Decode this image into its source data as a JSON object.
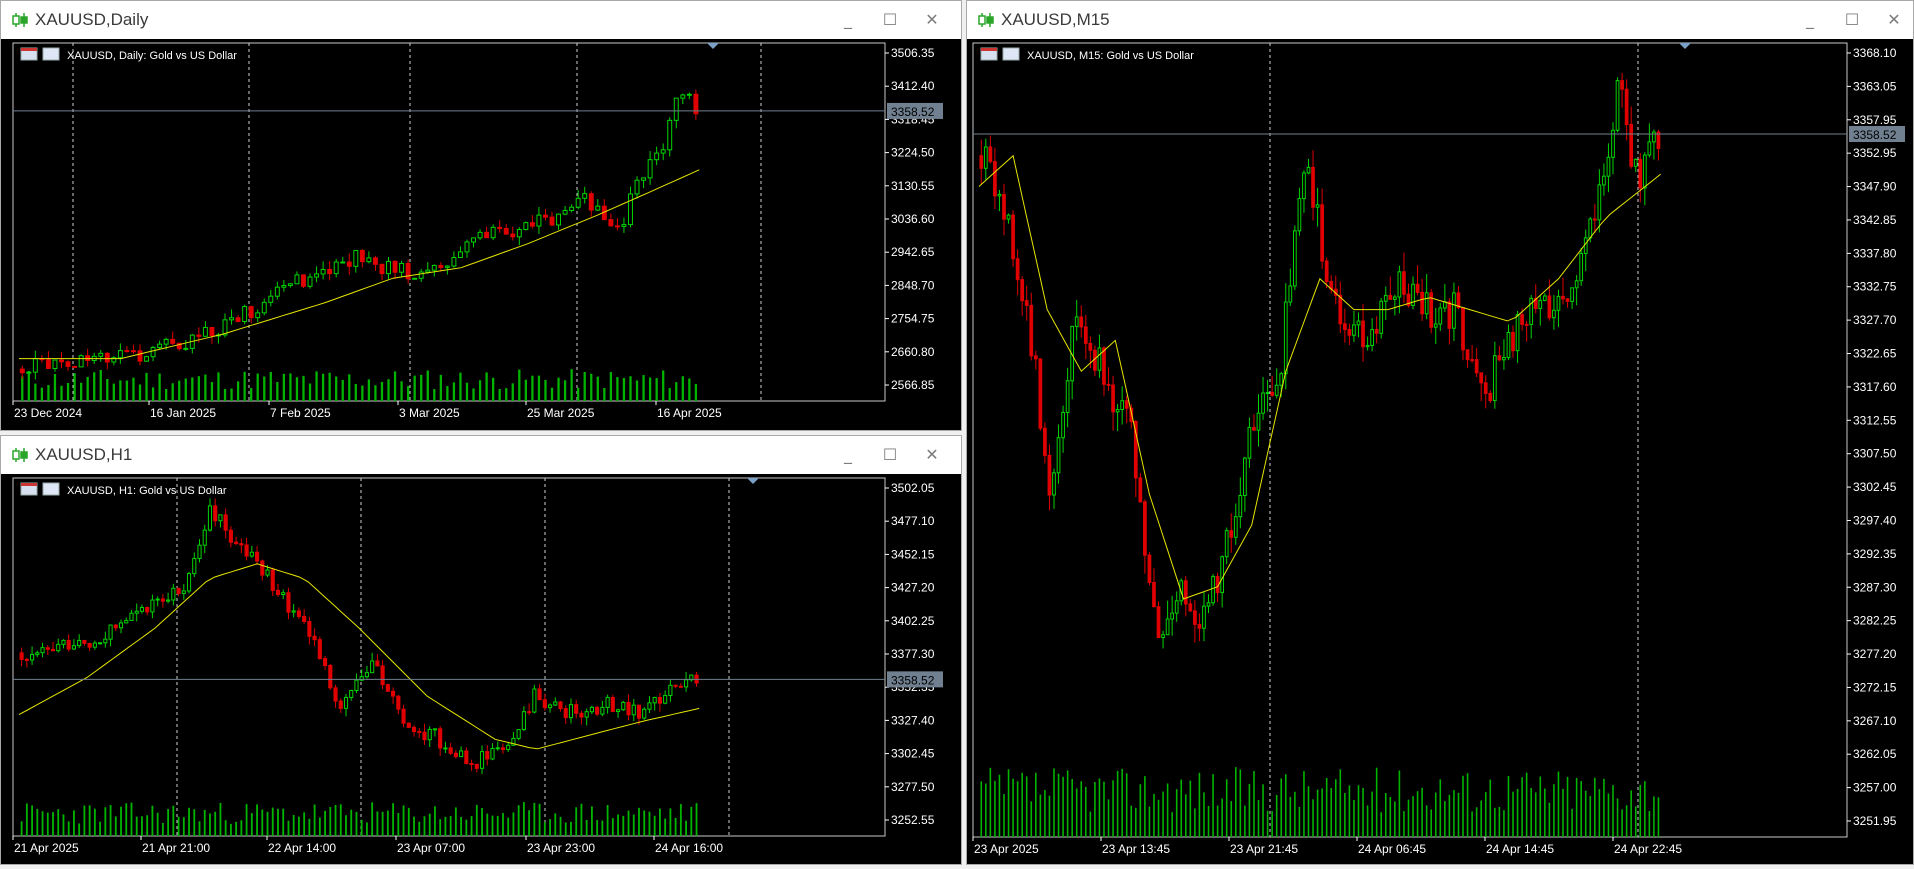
{
  "theme": {
    "bg": "#000000",
    "bull": "#00d400",
    "bear": "#e00000",
    "ma": "#e6e600",
    "volume": "#00b400",
    "axis": "#ffffff",
    "grid": "#cfcfcf",
    "price_line": "#708090",
    "price_tag_bg": "#708090"
  },
  "windows": [
    {
      "id": "daily",
      "title": "XAUUSD,Daily",
      "legend": "XAUUSD, Daily:  Gold vs US Dollar",
      "current_price": "3358.52",
      "price_level": 3358.52,
      "y_ticks": [
        "3506.35",
        "3412.40",
        "3318.45",
        "3224.50",
        "3130.55",
        "3036.60",
        "2942.65",
        "2848.70",
        "2754.75",
        "2660.80",
        "2566.85"
      ],
      "x_labels": [
        "23 Dec 2024",
        "16 Jan 2025",
        "7 Feb 2025",
        "3 Mar 2025",
        "25 Mar 2025",
        "16 Apr 2025"
      ],
      "ylim": [
        2540,
        3530
      ],
      "path": [
        [
          0,
          2620
        ],
        [
          0.03,
          2630
        ],
        [
          0.1,
          2640
        ],
        [
          0.18,
          2665
        ],
        [
          0.28,
          2720
        ],
        [
          0.35,
          2800
        ],
        [
          0.42,
          2880
        ],
        [
          0.5,
          2940
        ],
        [
          0.56,
          2900
        ],
        [
          0.62,
          2910
        ],
        [
          0.68,
          2990
        ],
        [
          0.74,
          3030
        ],
        [
          0.8,
          3060
        ],
        [
          0.84,
          3110
        ],
        [
          0.88,
          3000
        ],
        [
          0.91,
          3130
        ],
        [
          0.95,
          3260
        ],
        [
          0.98,
          3420
        ],
        [
          1.0,
          3358
        ]
      ],
      "ma_path": [
        [
          0,
          2650
        ],
        [
          0.15,
          2650
        ],
        [
          0.3,
          2720
        ],
        [
          0.45,
          2810
        ],
        [
          0.55,
          2880
        ],
        [
          0.65,
          2910
        ],
        [
          0.75,
          2980
        ],
        [
          0.85,
          3060
        ],
        [
          0.92,
          3120
        ],
        [
          1.0,
          3190
        ]
      ],
      "candles": 104,
      "seed": 11
    },
    {
      "id": "h1",
      "title": "XAUUSD,H1",
      "legend": "XAUUSD, H1:  Gold vs US Dollar",
      "current_price": "3358.52",
      "price_level": 3358.52,
      "y_ticks": [
        "3502.05",
        "3477.10",
        "3452.15",
        "3427.20",
        "3402.25",
        "3377.30",
        "3352.35",
        "3327.40",
        "3302.45",
        "3277.50",
        "3252.55"
      ],
      "x_labels": [
        "21 Apr 2025",
        "21 Apr 21:00",
        "22 Apr 14:00",
        "23 Apr 07:00",
        "23 Apr 23:00",
        "24 Apr 16:00"
      ],
      "ylim": [
        3235,
        3515
      ],
      "path": [
        [
          0,
          3380
        ],
        [
          0.1,
          3390
        ],
        [
          0.2,
          3420
        ],
        [
          0.25,
          3440
        ],
        [
          0.28,
          3495
        ],
        [
          0.32,
          3470
        ],
        [
          0.38,
          3430
        ],
        [
          0.43,
          3395
        ],
        [
          0.47,
          3340
        ],
        [
          0.52,
          3370
        ],
        [
          0.57,
          3320
        ],
        [
          0.62,
          3310
        ],
        [
          0.66,
          3290
        ],
        [
          0.72,
          3300
        ],
        [
          0.76,
          3345
        ],
        [
          0.82,
          3330
        ],
        [
          0.88,
          3340
        ],
        [
          0.92,
          3330
        ],
        [
          0.96,
          3355
        ],
        [
          1.0,
          3358
        ]
      ],
      "ma_path": [
        [
          0,
          3330
        ],
        [
          0.1,
          3360
        ],
        [
          0.2,
          3400
        ],
        [
          0.28,
          3440
        ],
        [
          0.35,
          3452
        ],
        [
          0.42,
          3440
        ],
        [
          0.5,
          3400
        ],
        [
          0.6,
          3345
        ],
        [
          0.7,
          3310
        ],
        [
          0.76,
          3302
        ],
        [
          0.85,
          3315
        ],
        [
          0.92,
          3325
        ],
        [
          1.0,
          3335
        ]
      ],
      "candles": 130,
      "seed": 23
    },
    {
      "id": "m15",
      "title": "XAUUSD,M15",
      "legend": "XAUUSD, M15:  Gold vs US Dollar",
      "current_price": "3358.52",
      "price_level": 3358.52,
      "y_ticks": [
        "3368.10",
        "3363.05",
        "3357.95",
        "3352.95",
        "3347.90",
        "3342.85",
        "3337.80",
        "3332.75",
        "3327.70",
        "3322.65",
        "3317.60",
        "3312.55",
        "3307.50",
        "3302.45",
        "3297.40",
        "3292.35",
        "3287.30",
        "3282.25",
        "3277.20",
        "3272.15",
        "3267.10",
        "3262.05",
        "3257.00",
        "3251.95"
      ],
      "x_labels": [
        "23 Apr 2025",
        "23 Apr 13:45",
        "23 Apr 21:45",
        "24 Apr 06:45",
        "24 Apr 14:45",
        "24 Apr 22:45"
      ],
      "ylim": [
        3245,
        3372
      ],
      "path": [
        [
          0,
          3355
        ],
        [
          0.04,
          3345
        ],
        [
          0.08,
          3320
        ],
        [
          0.1,
          3300
        ],
        [
          0.14,
          3330
        ],
        [
          0.18,
          3320
        ],
        [
          0.22,
          3310
        ],
        [
          0.26,
          3275
        ],
        [
          0.29,
          3285
        ],
        [
          0.33,
          3280
        ],
        [
          0.37,
          3295
        ],
        [
          0.4,
          3310
        ],
        [
          0.44,
          3320
        ],
        [
          0.48,
          3355
        ],
        [
          0.52,
          3330
        ],
        [
          0.57,
          3325
        ],
        [
          0.62,
          3335
        ],
        [
          0.66,
          3330
        ],
        [
          0.7,
          3330
        ],
        [
          0.74,
          3315
        ],
        [
          0.78,
          3325
        ],
        [
          0.82,
          3330
        ],
        [
          0.88,
          3335
        ],
        [
          0.92,
          3350
        ],
        [
          0.94,
          3368
        ],
        [
          0.97,
          3350
        ],
        [
          1.0,
          3358
        ]
      ],
      "ma_path": [
        [
          0,
          3350
        ],
        [
          0.05,
          3355
        ],
        [
          0.1,
          3330
        ],
        [
          0.15,
          3320
        ],
        [
          0.2,
          3325
        ],
        [
          0.25,
          3300
        ],
        [
          0.3,
          3283
        ],
        [
          0.35,
          3285
        ],
        [
          0.4,
          3295
        ],
        [
          0.45,
          3320
        ],
        [
          0.5,
          3335
        ],
        [
          0.55,
          3330
        ],
        [
          0.6,
          3330
        ],
        [
          0.66,
          3332
        ],
        [
          0.72,
          3330
        ],
        [
          0.78,
          3328
        ],
        [
          0.85,
          3335
        ],
        [
          0.92,
          3345
        ],
        [
          1.0,
          3352
        ]
      ],
      "candles": 150,
      "seed": 37
    }
  ]
}
